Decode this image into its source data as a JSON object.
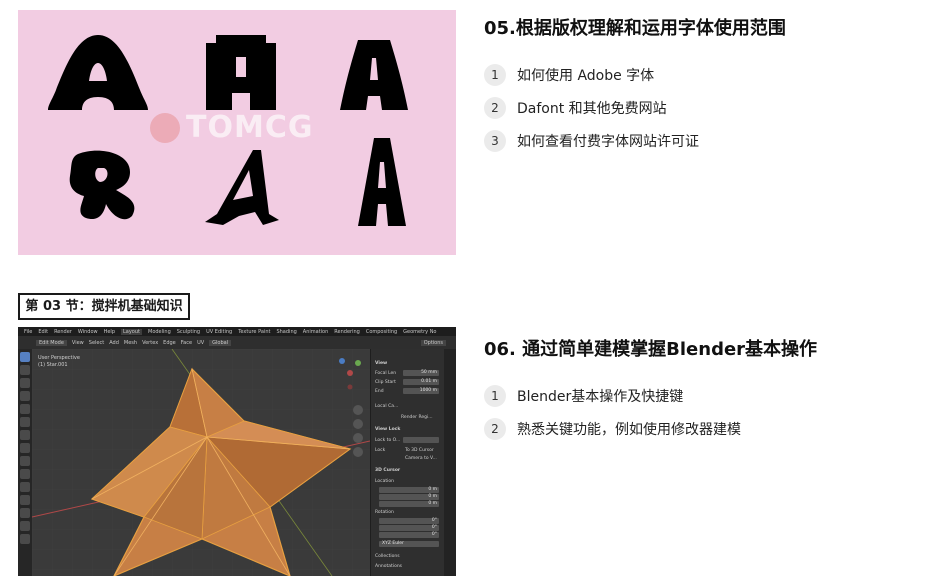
{
  "section1": {
    "title": "05.根据版权理解和运用字体使用范围",
    "items": [
      {
        "num": "1",
        "text": "如何使用 Adobe 字体"
      },
      {
        "num": "2",
        "text": "Dafont 和其他免费网站"
      },
      {
        "num": "3",
        "text": "如何查看付费字体网站许可证"
      }
    ],
    "image": {
      "background": "#f2cce2",
      "glyphs": [
        "A",
        "A",
        "A",
        "R",
        "A",
        "A"
      ],
      "watermark": "TOMCG"
    }
  },
  "section_label": "第 03 节：搅拌机基础知识",
  "section2": {
    "title": "06. 通过简单建模掌握Blender基本操作",
    "items": [
      {
        "num": "1",
        "text": "Blender基本操作及快捷键"
      },
      {
        "num": "2",
        "text": "熟悉关键功能，例如使用修改器建模"
      }
    ]
  },
  "blender": {
    "menu": [
      "File",
      "Edit",
      "Render",
      "Window",
      "Help"
    ],
    "workspaces": [
      "Layout",
      "Modeling",
      "Sculpting",
      "UV Editing",
      "Texture Paint",
      "Shading",
      "Animation",
      "Rendering",
      "Compositing",
      "Geometry No"
    ],
    "active_workspace": "Layout",
    "mode": "Edit Mode",
    "header_menu": [
      "View",
      "Select",
      "Add",
      "Mesh",
      "Vertex",
      "Edge",
      "Face",
      "UV"
    ],
    "orientation": "Global",
    "view_label": "User Perspective",
    "object_label": "(1) Star.001",
    "options_label": "Options",
    "panel": {
      "view_title": "View",
      "focal_length_label": "Focal Len",
      "focal_length": "50 mm",
      "clip_start_label": "Clip Start",
      "clip_start": "0.01 m",
      "clip_end_label": "End",
      "clip_end": "1000 m",
      "local_camera_label": "Local Ca...",
      "render_region": "Render Regi...",
      "view_lock_title": "View Lock",
      "lock_to_object_label": "Lock to O...",
      "lock_label": "Lock",
      "to_3d_cursor": "To 3D Cursor",
      "camera_to_view": "Camera to V...",
      "cursor_title": "3D Cursor",
      "location_label": "Location",
      "location": [
        "0 m",
        "0 m",
        "0 m"
      ],
      "rotation_label": "Rotation",
      "rotation": [
        "0°",
        "0°",
        "0°"
      ],
      "rotation_mode": "XYZ Euler",
      "collections": "Collections",
      "annotations": "Annotations"
    },
    "colors": {
      "mesh": "#c77f45",
      "edge": "#e8a040",
      "axis_x": "#b04848"
    }
  }
}
